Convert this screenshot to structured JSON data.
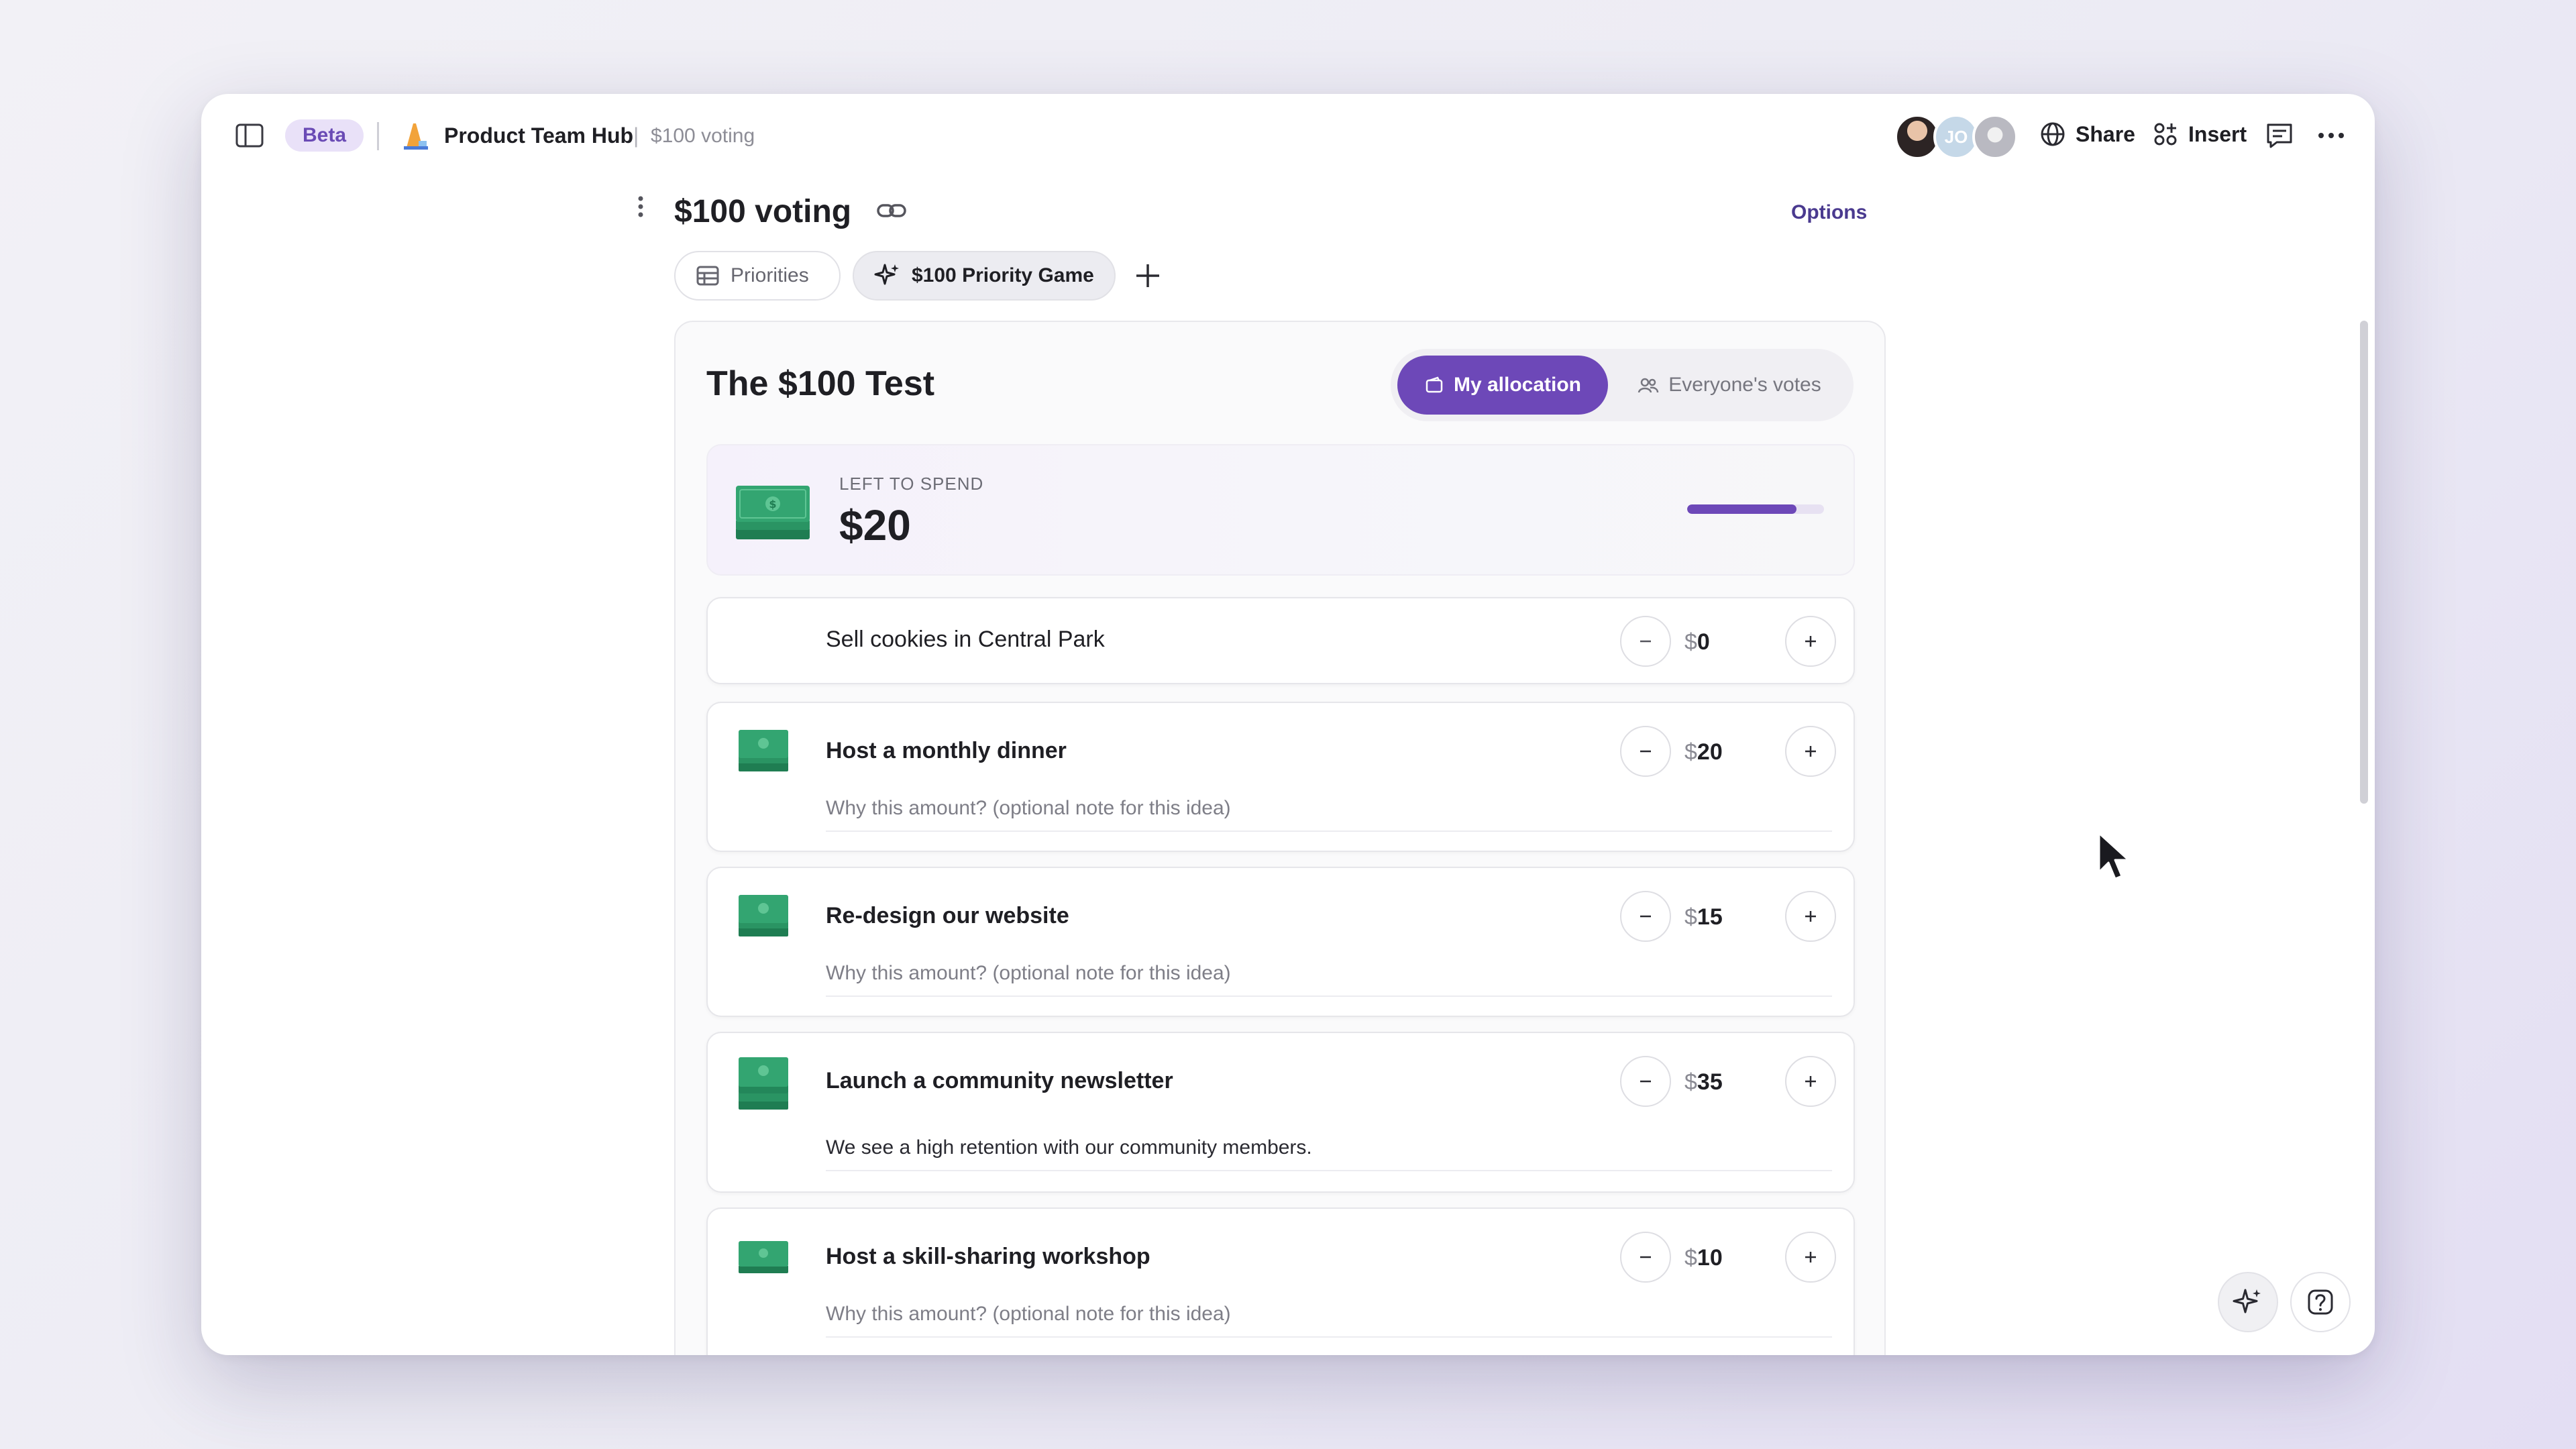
{
  "topbar": {
    "beta_label": "Beta",
    "hub_title": "Product Team Hub",
    "separator": "|",
    "breadcrumb": "$100 voting",
    "avatars": [
      {
        "initials": ""
      },
      {
        "initials": "JO"
      },
      {
        "initials": ""
      }
    ],
    "share_label": "Share",
    "insert_label": "Insert"
  },
  "doc": {
    "title": "$100 voting",
    "options_label": "Options",
    "tabs": [
      {
        "label": "Priorities",
        "icon": "table-icon"
      },
      {
        "label": "$100 Priority Game",
        "icon": "sparkle-icon"
      }
    ]
  },
  "game": {
    "title": "The $100 Test",
    "segments": {
      "mine": "My allocation",
      "everyone": "Everyone's votes"
    },
    "spend": {
      "label": "LEFT TO SPEND",
      "value": "$20",
      "allocated_fraction": 0.8
    },
    "currency": "$",
    "ideas": [
      {
        "name": "Sell cookies in Central Park",
        "amount": "0",
        "note": ""
      },
      {
        "name": "Host a monthly dinner",
        "amount": "20",
        "note": "Why this amount? (optional note for this idea)"
      },
      {
        "name": "Re-design our website",
        "amount": "15",
        "note": "Why this amount? (optional note for this idea)"
      },
      {
        "name": "Launch a community newsletter",
        "amount": "35",
        "note": "We see a high retention with our community members."
      },
      {
        "name": "Host a skill-sharing workshop",
        "amount": "10",
        "note": "Why this amount? (optional note for this idea)"
      }
    ]
  },
  "colors": {
    "accent": "#6d48b8",
    "money_green": "#2e9e6a"
  }
}
